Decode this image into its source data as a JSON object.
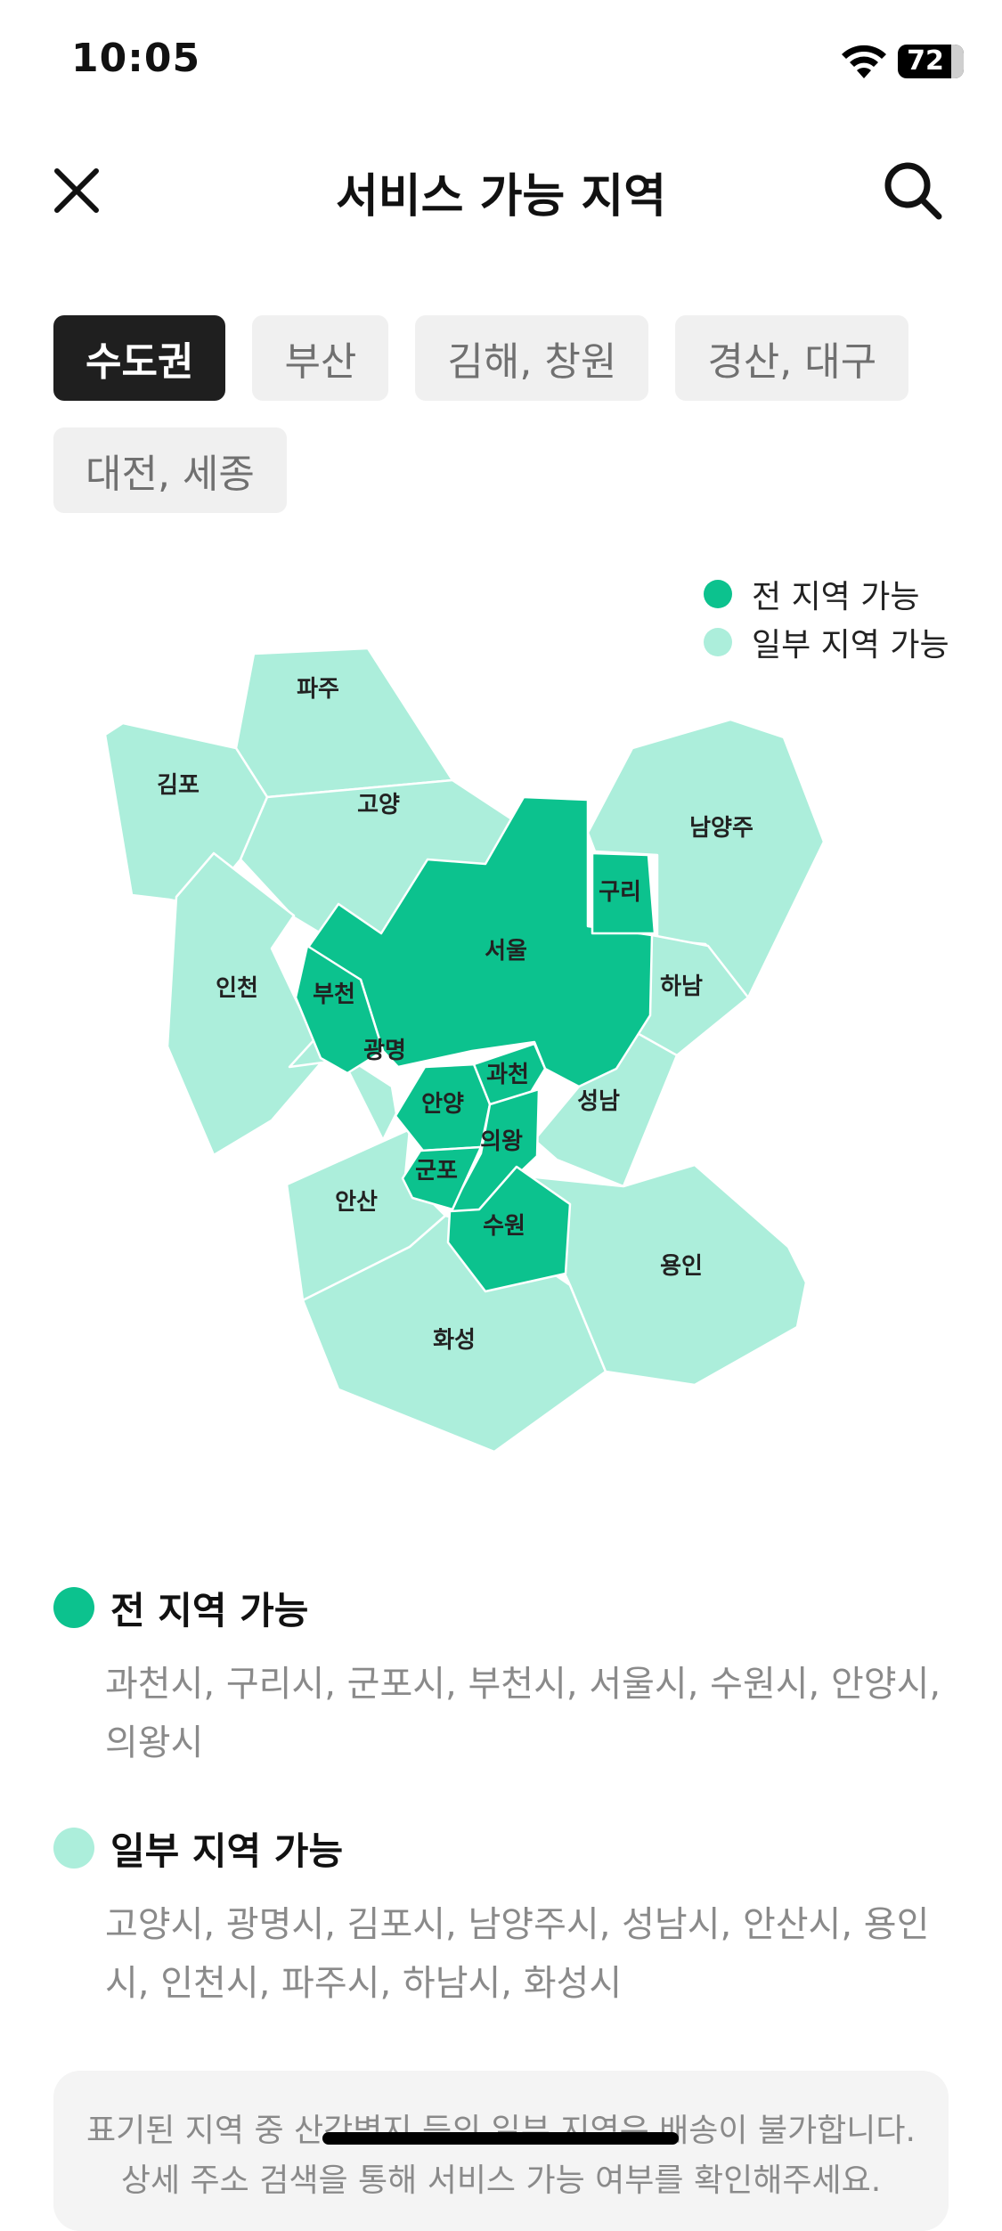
{
  "status_bar": {
    "time": "10:05",
    "battery": "72"
  },
  "header": {
    "title": "서비스 가능 지역"
  },
  "region_tabs": [
    {
      "label": "수도권",
      "active": true
    },
    {
      "label": "부산",
      "active": false
    },
    {
      "label": "김해, 창원",
      "active": false
    },
    {
      "label": "경산, 대구",
      "active": false
    },
    {
      "label": "대전, 세종",
      "active": false
    }
  ],
  "legend": {
    "full": "전 지역 가능",
    "partial": "일부 지역 가능"
  },
  "colors": {
    "full": "#0cc28e",
    "partial": "#aceedb",
    "accent_dark": "#1f1f1f"
  },
  "map": {
    "labels": {
      "paju": "파주",
      "gimpo": "김포",
      "goyang": "고양",
      "namyangju": "남양주",
      "guri": "구리",
      "seoul": "서울",
      "hanam": "하남",
      "incheon": "인천",
      "bucheon": "부천",
      "gwangmyeong": "광명",
      "gwacheon": "과천",
      "anyang": "안양",
      "seongnam": "성남",
      "uiwang": "의왕",
      "gunpo": "군포",
      "ansan": "안산",
      "suwon": "수원",
      "yongin": "용인",
      "hwaseong": "화성"
    }
  },
  "lists": {
    "full": {
      "title": "전 지역 가능",
      "items": "과천시, 구리시, 군포시, 부천시, 서울시, 수원시, 안양시, 의왕시"
    },
    "partial": {
      "title": "일부 지역 가능",
      "items": "고양시, 광명시, 김포시, 남양주시, 성남시, 안산시, 용인시, 인천시, 파주시, 하남시, 화성시"
    }
  },
  "notice": {
    "line1": "표기된 지역 중 산간벽지 등의 일부 지역은 배송이 불가합니다.",
    "line2": "상세 주소 검색을 통해 서비스 가능 여부를 확인해주세요."
  }
}
